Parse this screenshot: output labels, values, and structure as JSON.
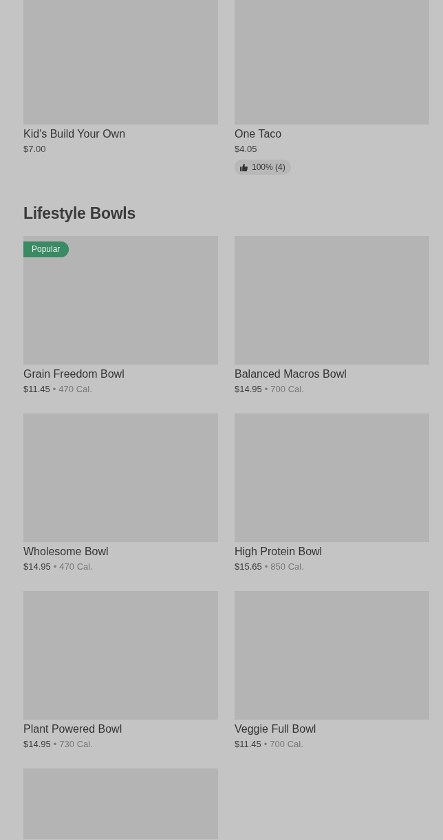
{
  "sections": [
    {
      "items": [
        {
          "name": "Kid's Build Your Own",
          "price": "$7.00"
        },
        {
          "name": "One Taco",
          "price": "$4.05",
          "rating": "100% (4)"
        }
      ]
    },
    {
      "title": "Lifestyle Bowls",
      "items": [
        {
          "name": "Grain Freedom Bowl",
          "price": "$11.45",
          "separator": "•",
          "calories": "470 Cal.",
          "badge": "Popular"
        },
        {
          "name": "Balanced Macros Bowl",
          "price": "$14.95",
          "separator": "•",
          "calories": "700 Cal."
        },
        {
          "name": "Wholesome Bowl",
          "price": "$14.95",
          "separator": "•",
          "calories": "470 Cal."
        },
        {
          "name": "High Protein Bowl",
          "price": "$15.65",
          "separator": "•",
          "calories": "850 Cal."
        },
        {
          "name": "Plant Powered Bowl",
          "price": "$14.95",
          "separator": "•",
          "calories": "730 Cal."
        },
        {
          "name": "Veggie Full Bowl",
          "price": "$11.45",
          "separator": "•",
          "calories": "700 Cal."
        },
        {
          "kind": "picture"
        }
      ]
    }
  ]
}
